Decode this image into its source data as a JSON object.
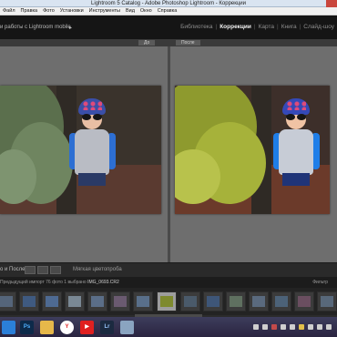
{
  "window": {
    "title": "Lightroom 5 Catalog - Adobe Photoshop Lightroom - Коррекции"
  },
  "menu": [
    "Файл",
    "Правка",
    "Фото",
    "Установки",
    "Инструменты",
    "Вид",
    "Окно",
    "Справка"
  ],
  "header": {
    "catalog_link": "и работы с Lightroom mobile",
    "modules": [
      "Библиотека",
      "Коррекции",
      "Карта",
      "Книга",
      "Слайд-шоу"
    ],
    "active_module": "Коррекции"
  },
  "compare": {
    "before_label": "До",
    "after_label": "После"
  },
  "toolbar": {
    "view_mode": "о и После",
    "soft_proof_label": "Мягкая цветопроба"
  },
  "filmstrip": {
    "source": "Предыдущий импорт",
    "count": "76 фото",
    "selected": "1 выбрано",
    "filename": "IMG_0693.CR2",
    "filter_label": "Фильтр"
  },
  "colors": {
    "active_module": "#f2f2f2",
    "panel_dark": "#151515",
    "work_bg": "#6e6e6e",
    "selected_thumb": "#9d9d9d"
  },
  "taskbar": {
    "icons": [
      "ie-icon",
      "photoshop-icon",
      "explorer-icon",
      "yandex-icon",
      "youtube-icon",
      "lightroom-icon",
      "files-icon"
    ]
  }
}
